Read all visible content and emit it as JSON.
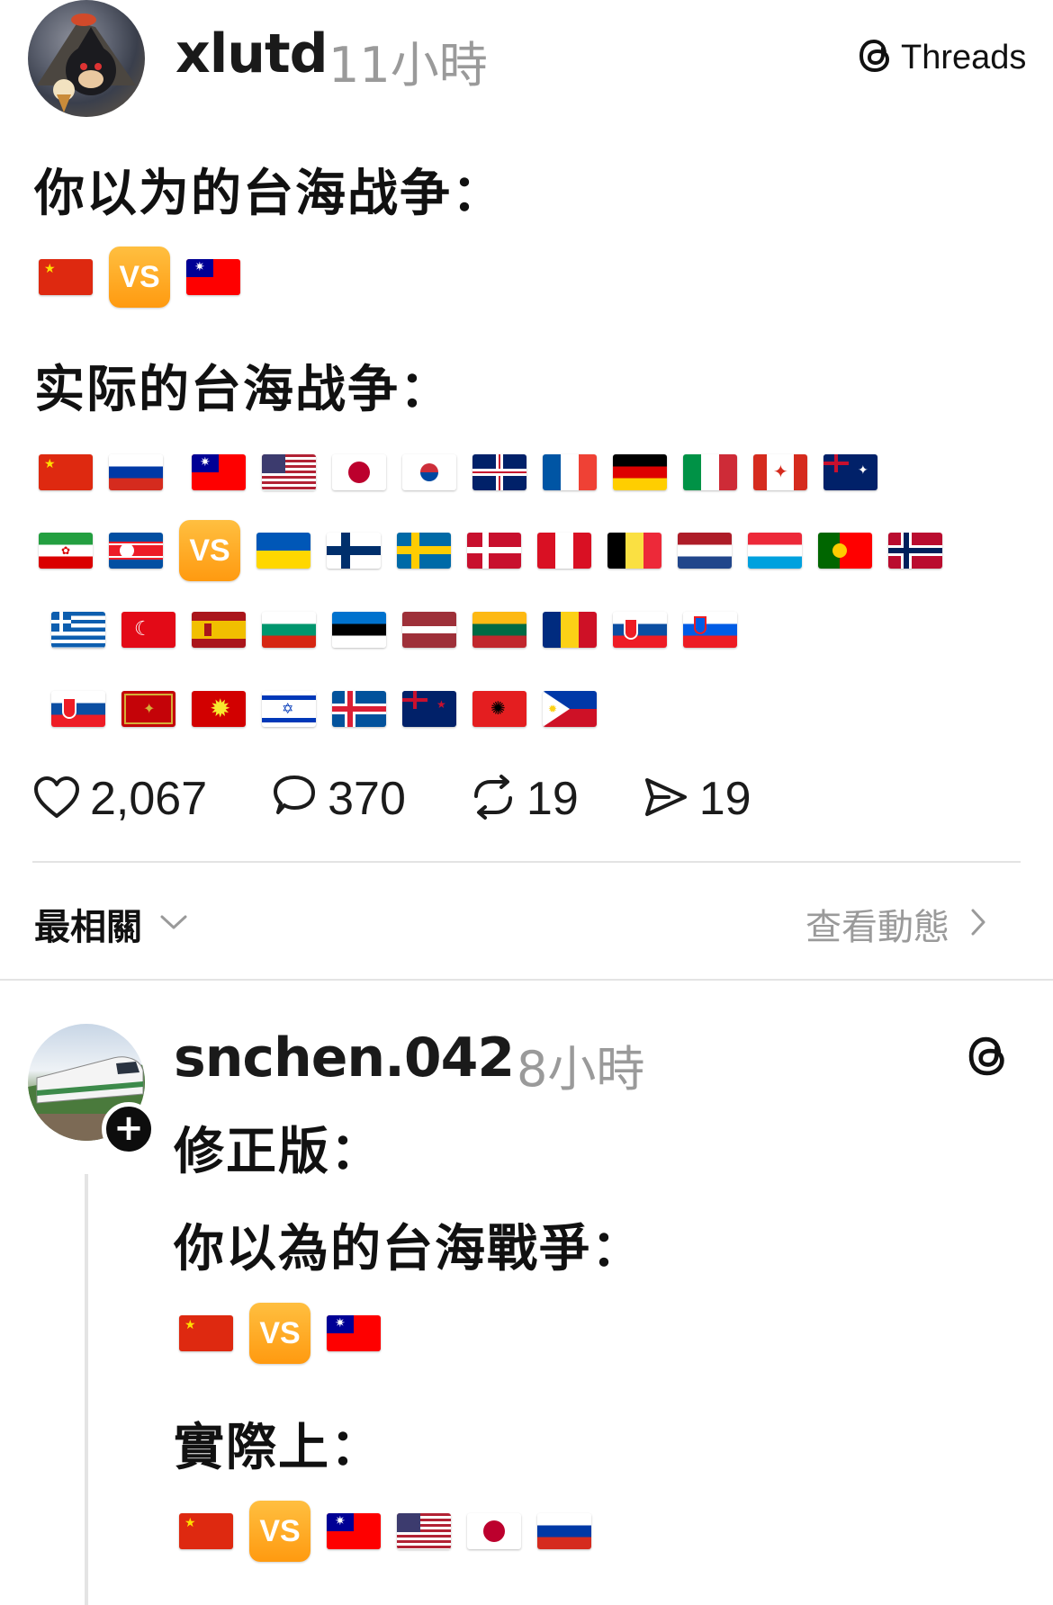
{
  "post": {
    "username": "xlutd",
    "time": "11小時",
    "app_label": "Threads",
    "line1": "你以为的台海战争：",
    "row1": [
      "cn",
      "vs",
      "tw"
    ],
    "line2": "实际的台海战争：",
    "flag_rows": [
      [
        "cn",
        "ru",
        "gap",
        "tw",
        "us",
        "jp",
        "kr",
        "gb",
        "fr",
        "de",
        "it",
        "ca",
        "au"
      ],
      [
        "ir",
        "kp",
        "vs",
        "ua",
        "fi",
        "se",
        "dk",
        "pe",
        "be",
        "nl",
        "lu",
        "pt",
        "no"
      ],
      [
        "gr",
        "tr",
        "es",
        "bg",
        "ee",
        "lv",
        "lt",
        "ro",
        "sk",
        "si"
      ],
      [
        "sk",
        "me",
        "mk",
        "il",
        "is",
        "nz",
        "al",
        "ph"
      ]
    ],
    "actions": {
      "likes": "2,067",
      "replies": "370",
      "reposts": "19",
      "shares": "19"
    }
  },
  "sort": {
    "label": "最相關",
    "view_activity": "查看動態"
  },
  "reply": {
    "username": "snchen.042",
    "time": "8小時",
    "line1": "修正版：",
    "line2": "你以為的台海戰爭：",
    "row1": [
      "cn",
      "vs",
      "tw"
    ],
    "line3": "實際上：",
    "row2": [
      "cn",
      "vs",
      "tw",
      "us",
      "jp",
      "ru"
    ]
  },
  "colors": {
    "vs_orange": "#ff9a10",
    "time_gray": "#9a9a9a"
  }
}
